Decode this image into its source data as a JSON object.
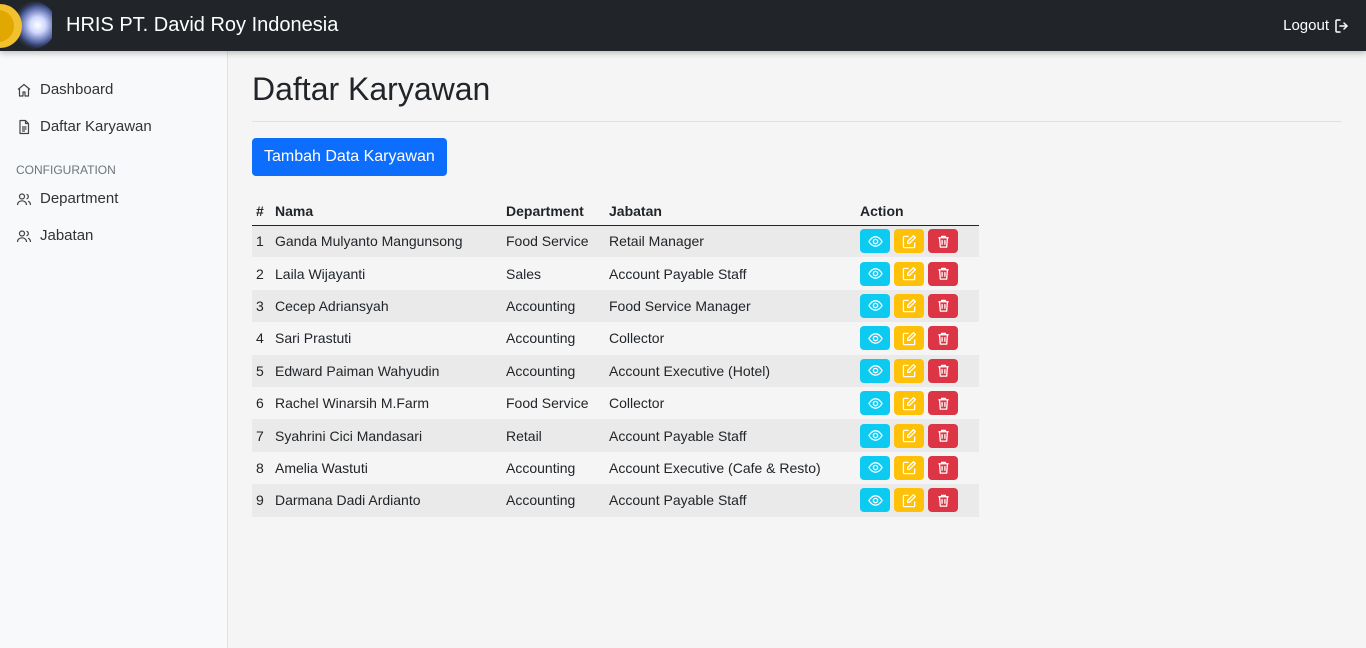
{
  "header": {
    "brand": "HRIS PT. David Roy Indonesia",
    "logout_label": "Logout"
  },
  "sidebar": {
    "items": [
      {
        "label": "Dashboard",
        "icon": "house-icon"
      },
      {
        "label": "Daftar Karyawan",
        "icon": "file-text-icon"
      }
    ],
    "config_heading": "CONFIGURATION",
    "config_items": [
      {
        "label": "Department",
        "icon": "people-icon"
      },
      {
        "label": "Jabatan",
        "icon": "people-icon"
      }
    ]
  },
  "main": {
    "title": "Daftar Karyawan",
    "add_button": "Tambah Data Karyawan",
    "table": {
      "headers": [
        "#",
        "Nama",
        "Department",
        "Jabatan",
        "Action"
      ],
      "rows": [
        {
          "num": "1",
          "nama": "Ganda Mulyanto Mangunsong",
          "department": "Food Service",
          "jabatan": "Retail Manager"
        },
        {
          "num": "2",
          "nama": "Laila Wijayanti",
          "department": "Sales",
          "jabatan": "Account Payable Staff"
        },
        {
          "num": "3",
          "nama": "Cecep Adriansyah",
          "department": "Accounting",
          "jabatan": "Food Service Manager"
        },
        {
          "num": "4",
          "nama": "Sari Prastuti",
          "department": "Accounting",
          "jabatan": "Collector"
        },
        {
          "num": "5",
          "nama": "Edward Paiman Wahyudin",
          "department": "Accounting",
          "jabatan": "Account Executive (Hotel)"
        },
        {
          "num": "6",
          "nama": "Rachel Winarsih M.Farm",
          "department": "Food Service",
          "jabatan": "Collector"
        },
        {
          "num": "7",
          "nama": "Syahrini Cici Mandasari",
          "department": "Retail",
          "jabatan": "Account Payable Staff"
        },
        {
          "num": "8",
          "nama": "Amelia Wastuti",
          "department": "Accounting",
          "jabatan": "Account Executive (Cafe & Resto)"
        },
        {
          "num": "9",
          "nama": "Darmana Dadi Ardianto",
          "department": "Accounting",
          "jabatan": "Account Payable Staff"
        }
      ]
    }
  },
  "colors": {
    "topbar": "#212529",
    "primary": "#0d6efd",
    "info": "#0dcaf0",
    "warning": "#ffc107",
    "danger": "#dc3545"
  }
}
